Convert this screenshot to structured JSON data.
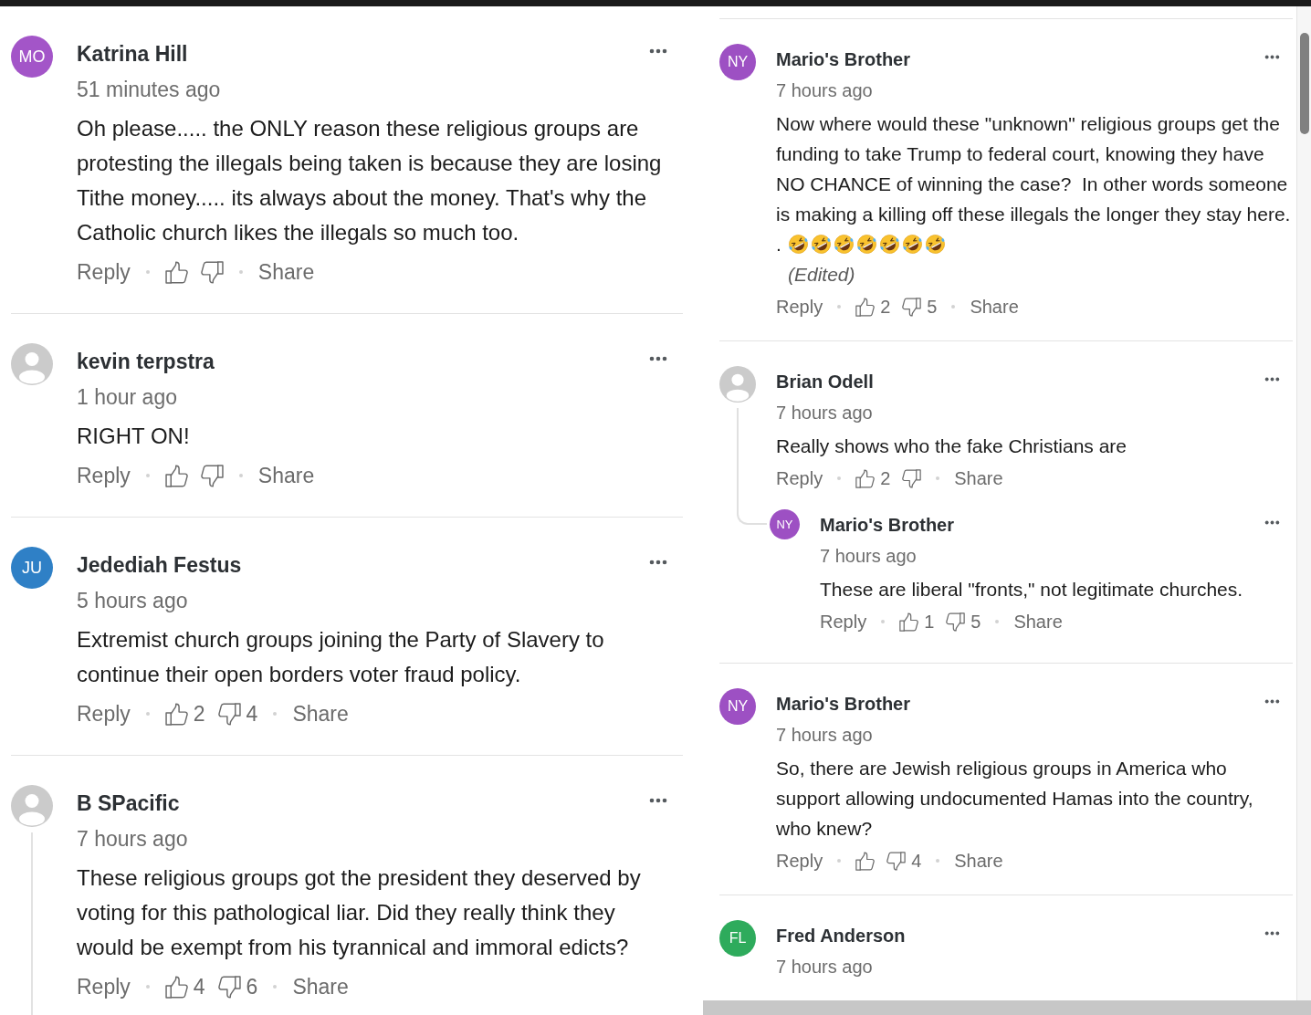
{
  "left_panel": {
    "comments": [
      {
        "avatar": {
          "kind": "initials",
          "initials": "MO",
          "color": "#a355c8"
        },
        "name": "Katrina Hill",
        "time": "51 minutes ago",
        "body": "Oh please..... the ONLY reason these religious groups are\nprotesting the illegals being taken is because they are losing\nTithe money..... its always about the money. That's why the\nCatholic church likes the illegals so much too.",
        "actions": {
          "reply": "Reply",
          "share": "Share"
        },
        "has_replies": false
      },
      {
        "avatar": {
          "kind": "default"
        },
        "name": "kevin terpstra",
        "time": "1 hour ago",
        "body": "RIGHT ON!",
        "actions": {
          "reply": "Reply",
          "share": "Share"
        },
        "has_replies": false
      },
      {
        "avatar": {
          "kind": "initials",
          "initials": "JU",
          "color": "#2f80c6"
        },
        "name": "Jedediah Festus",
        "time": "5 hours ago",
        "body": "Extremist church groups joining the Party of Slavery to\ncontinue their open borders voter fraud policy.",
        "actions": {
          "reply": "Reply",
          "likes": "2",
          "dislikes": "4",
          "share": "Share"
        },
        "has_replies": false
      },
      {
        "avatar": {
          "kind": "default"
        },
        "name": "B SPacific",
        "time": "7 hours ago",
        "body": "These religious groups got the president they deserved by\nvoting for this pathological liar. Did they really think they\nwould be exempt from his tyrannical and immoral edicts?",
        "actions": {
          "reply": "Reply",
          "likes": "4",
          "dislikes": "6",
          "share": "Share"
        },
        "has_replies": true
      }
    ]
  },
  "right_panel": {
    "comments": [
      {
        "avatar": {
          "kind": "initials",
          "initials": "NY",
          "color": "#9d50c3"
        },
        "name": "Mario's Brother",
        "time": "7 hours ago",
        "body": "Now where would these \"unknown\" religious groups get the\nfunding to take Trump to federal court, knowing they have\nNO CHANCE of winning the case?  In other words someone\nis making a killing off these illegals the longer they stay here.",
        "emoji_line": {
          "text": ".",
          "emojis": [
            {
              "kind": "rofl"
            },
            {
              "kind": "rofl"
            },
            {
              "kind": "rofl"
            },
            {
              "kind": "rofl"
            },
            {
              "kind": "rofl"
            },
            {
              "kind": "rofl"
            },
            {
              "kind": "rofl"
            }
          ]
        },
        "edited_label": "(Edited)",
        "actions": {
          "reply": "Reply",
          "likes": "2",
          "dislikes": "5",
          "share": "Share"
        },
        "has_replies": false
      },
      {
        "avatar": {
          "kind": "default"
        },
        "name": "Brian Odell",
        "time": "7 hours ago",
        "body": "Really shows who the fake Christians are",
        "actions": {
          "reply": "Reply",
          "likes": "2",
          "share": "Share"
        },
        "has_replies": true,
        "replies": [
          {
            "avatar": {
              "kind": "initials",
              "initials": "NY",
              "color": "#9d50c3"
            },
            "name": "Mario's Brother",
            "time": "7 hours ago",
            "body": "These are liberal \"fronts,\" not legitimate churches.",
            "actions": {
              "reply": "Reply",
              "likes": "1",
              "dislikes": "5",
              "share": "Share"
            },
            "has_replies": false
          }
        ]
      },
      {
        "avatar": {
          "kind": "initials",
          "initials": "NY",
          "color": "#9d50c3"
        },
        "name": "Mario's Brother",
        "time": "7 hours ago",
        "body": "So, there are Jewish religious groups in America who\nsupport allowing undocumented Hamas into the country,\nwho knew?",
        "actions": {
          "reply": "Reply",
          "dislikes": "4",
          "share": "Share"
        },
        "has_replies": false
      },
      {
        "avatar": {
          "kind": "initials",
          "initials": "FL",
          "color": "#2eab5c"
        },
        "name": "Fred Anderson",
        "time": "7 hours ago",
        "has_replies": false
      }
    ]
  }
}
